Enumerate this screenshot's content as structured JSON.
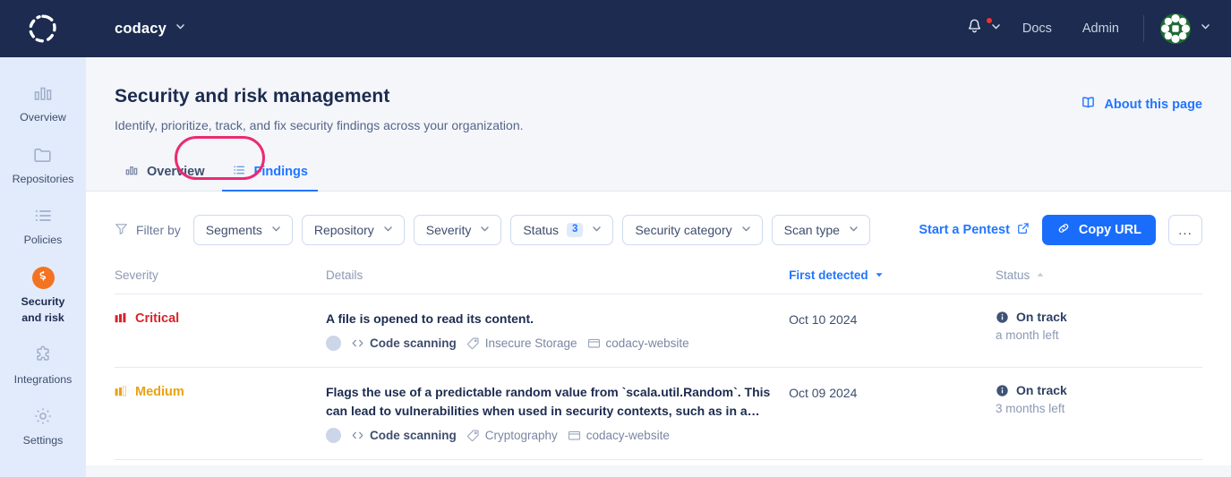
{
  "colors": {
    "nav_bg": "#1c2b4f",
    "sidebar_bg": "#e2ebfb",
    "accent_blue": "#2176ff",
    "primary_button": "#1a6dfb",
    "annotation_pink": "#ec2a70",
    "active_orange": "#f37321",
    "critical_red": "#d8232a",
    "medium_orange": "#e8a213",
    "page_bg": "#f4f6fa"
  },
  "topnav": {
    "logo_icon": "codacy-logo-icon",
    "org_name": "codacy",
    "org_chevron_icon": "chevron-down-icon",
    "notifications_icon": "bell-icon",
    "notifications_chevron_icon": "chevron-down-icon",
    "has_notification_dot": true,
    "links": [
      {
        "label": "Docs",
        "name": "docs"
      },
      {
        "label": "Admin",
        "name": "admin"
      }
    ],
    "avatar_icon": "user-avatar",
    "avatar_chevron_icon": "chevron-down-icon"
  },
  "sidebar": {
    "items": [
      {
        "label": "Overview",
        "icon": "bar-chart-icon",
        "active": false
      },
      {
        "label": "Repositories",
        "icon": "folder-icon",
        "active": false
      },
      {
        "label": "Policies",
        "icon": "list-icon",
        "active": false
      },
      {
        "label": "Security\nand risk",
        "icon": "security-badge-icon",
        "active": true,
        "line1": "Security",
        "line2": "and risk"
      },
      {
        "label": "Integrations",
        "icon": "puzzle-icon",
        "active": false
      },
      {
        "label": "Settings",
        "icon": "gear-icon",
        "active": false
      }
    ]
  },
  "page": {
    "title": "Security and risk management",
    "subtitle": "Identify, prioritize, track, and fix security findings across your organization.",
    "about_link": {
      "label": "About this page",
      "icon": "book-icon"
    }
  },
  "tabs": [
    {
      "label": "Overview",
      "icon": "bar-chart-icon",
      "active": false
    },
    {
      "label": "Findings",
      "icon": "list-icon",
      "active": true,
      "annotated": true
    }
  ],
  "filters": {
    "filter_by_label": "Filter by",
    "filter_icon": "funnel-icon",
    "dropdowns": [
      {
        "label": "Segments",
        "count": null,
        "chevron_icon": "chevron-down-icon"
      },
      {
        "label": "Repository",
        "count": null,
        "chevron_icon": "chevron-down-icon"
      },
      {
        "label": "Severity",
        "count": null,
        "chevron_icon": "chevron-down-icon"
      },
      {
        "label": "Status",
        "count": "3",
        "chevron_icon": "chevron-down-icon"
      },
      {
        "label": "Security category",
        "count": null,
        "chevron_icon": "chevron-down-icon"
      },
      {
        "label": "Scan type",
        "count": null,
        "chevron_icon": "chevron-down-icon"
      }
    ],
    "pentest_link": {
      "label": "Start a Pentest",
      "icon": "external-link-icon"
    },
    "copy_url_button": {
      "label": "Copy URL",
      "icon": "link-icon"
    },
    "more_button": {
      "label": "...",
      "icon": "ellipsis-icon"
    }
  },
  "table": {
    "columns": [
      {
        "label": "Severity",
        "sorted": false,
        "sort_icon": null
      },
      {
        "label": "Details",
        "sorted": false,
        "sort_icon": null
      },
      {
        "label": "First detected",
        "sorted": true,
        "sort_icon": "caret-down-icon"
      },
      {
        "label": "Status",
        "sorted": false,
        "sort_icon": "caret-up-icon"
      }
    ],
    "rows": [
      {
        "severity": {
          "label": "Critical",
          "level": "critical",
          "filled_bars": 3,
          "icon": "severity-bars-icon"
        },
        "details": {
          "title": "A file is opened to read its content.",
          "avatar_icon": "assignee-avatar-icon",
          "scan_type": {
            "label": "Code scanning",
            "icon": "code-brackets-icon"
          },
          "category": {
            "label": "Insecure Storage",
            "icon": "tag-icon"
          },
          "repository": {
            "label": "codacy-website",
            "icon": "folder-icon"
          }
        },
        "first_detected": "Oct 10 2024",
        "status": {
          "icon": "info-circle-icon",
          "label": "On track",
          "sub": "a month left"
        }
      },
      {
        "severity": {
          "label": "Medium",
          "level": "medium",
          "filled_bars": 2,
          "icon": "severity-bars-icon"
        },
        "details": {
          "title": "Flags the use of a predictable random value from `scala.util.Random`. This can lead to vulnerabilities when used in security contexts, such as in a…",
          "avatar_icon": "assignee-avatar-icon",
          "scan_type": {
            "label": "Code scanning",
            "icon": "code-brackets-icon"
          },
          "category": {
            "label": "Cryptography",
            "icon": "tag-icon"
          },
          "repository": {
            "label": "codacy-website",
            "icon": "folder-icon"
          }
        },
        "first_detected": "Oct 09 2024",
        "status": {
          "icon": "info-circle-icon",
          "label": "On track",
          "sub": "3 months left"
        }
      }
    ]
  }
}
